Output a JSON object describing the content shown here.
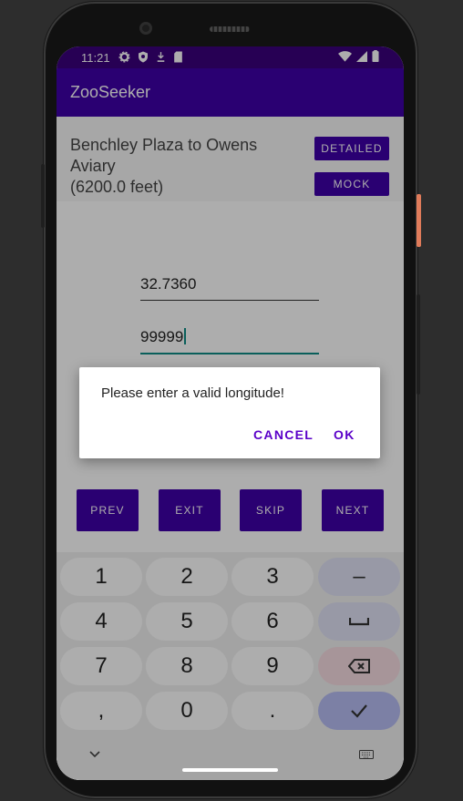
{
  "status_bar": {
    "time": "11:21",
    "left_icons": [
      "gear-icon",
      "shield-icon",
      "download-icon",
      "sd-card-icon"
    ],
    "right_icons": [
      "wifi-icon",
      "signal-icon",
      "battery-icon"
    ]
  },
  "app": {
    "title": "ZooSeeker"
  },
  "route": {
    "line1": "Benchley Plaza to Owens",
    "line2": "Aviary",
    "line3": "(6200.0 feet)",
    "detailed_label": "DETAILED",
    "mock_label": "MOCK"
  },
  "fields": {
    "latitude_value": "32.7360",
    "longitude_value": "99999"
  },
  "nav": {
    "prev": "PREV",
    "exit": "EXIT",
    "skip": "SKIP",
    "next": "NEXT"
  },
  "keyboard": {
    "rows": [
      [
        "1",
        "2",
        "3",
        "–"
      ],
      [
        "4",
        "5",
        "6",
        "␣"
      ],
      [
        "7",
        "8",
        "9",
        "⌫"
      ],
      [
        ",",
        "0",
        ".",
        "✓"
      ]
    ]
  },
  "dialog": {
    "message": "Please enter a valid longitude!",
    "cancel": "CANCEL",
    "ok": "OK"
  },
  "colors": {
    "primary": "#3f00a8",
    "status_bar": "#3a007d",
    "accent": "#0f8d86",
    "dialog_button": "#5a00c8"
  }
}
